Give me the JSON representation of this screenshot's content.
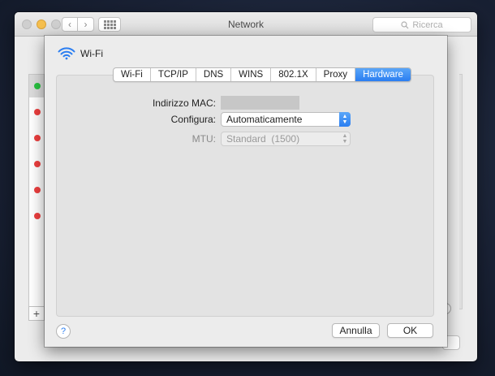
{
  "window": {
    "title": "Network",
    "search_placeholder": "Ricerca"
  },
  "sidebar": {
    "status_dots": [
      {
        "color": "#29c341",
        "status": "connected"
      },
      {
        "color": "#ed3f3f",
        "status": "disconnected"
      },
      {
        "color": "#ed3f3f",
        "status": "disconnected"
      },
      {
        "color": "#ed3f3f",
        "status": "disconnected"
      },
      {
        "color": "#ed3f3f",
        "status": "disconnected"
      },
      {
        "color": "#ed3f3f",
        "status": "disconnected"
      }
    ],
    "add_label": "+"
  },
  "sheet": {
    "interface_name": "Wi-Fi",
    "tabs": [
      {
        "label": "Wi-Fi",
        "active": false
      },
      {
        "label": "TCP/IP",
        "active": false
      },
      {
        "label": "DNS",
        "active": false
      },
      {
        "label": "WINS",
        "active": false
      },
      {
        "label": "802.1X",
        "active": false
      },
      {
        "label": "Proxy",
        "active": false
      },
      {
        "label": "Hardware",
        "active": true
      }
    ],
    "fields": {
      "mac_label": "Indirizzo MAC:",
      "configure_label": "Configura:",
      "configure_value": "Automaticamente",
      "mtu_label": "MTU:",
      "mtu_value": "Standard  (1500)"
    },
    "help_label": "?",
    "cancel_label": "Annulla",
    "ok_label": "OK"
  },
  "colors": {
    "accent": "#2b7ef1",
    "wifi_icon": "#2b7ef1"
  }
}
